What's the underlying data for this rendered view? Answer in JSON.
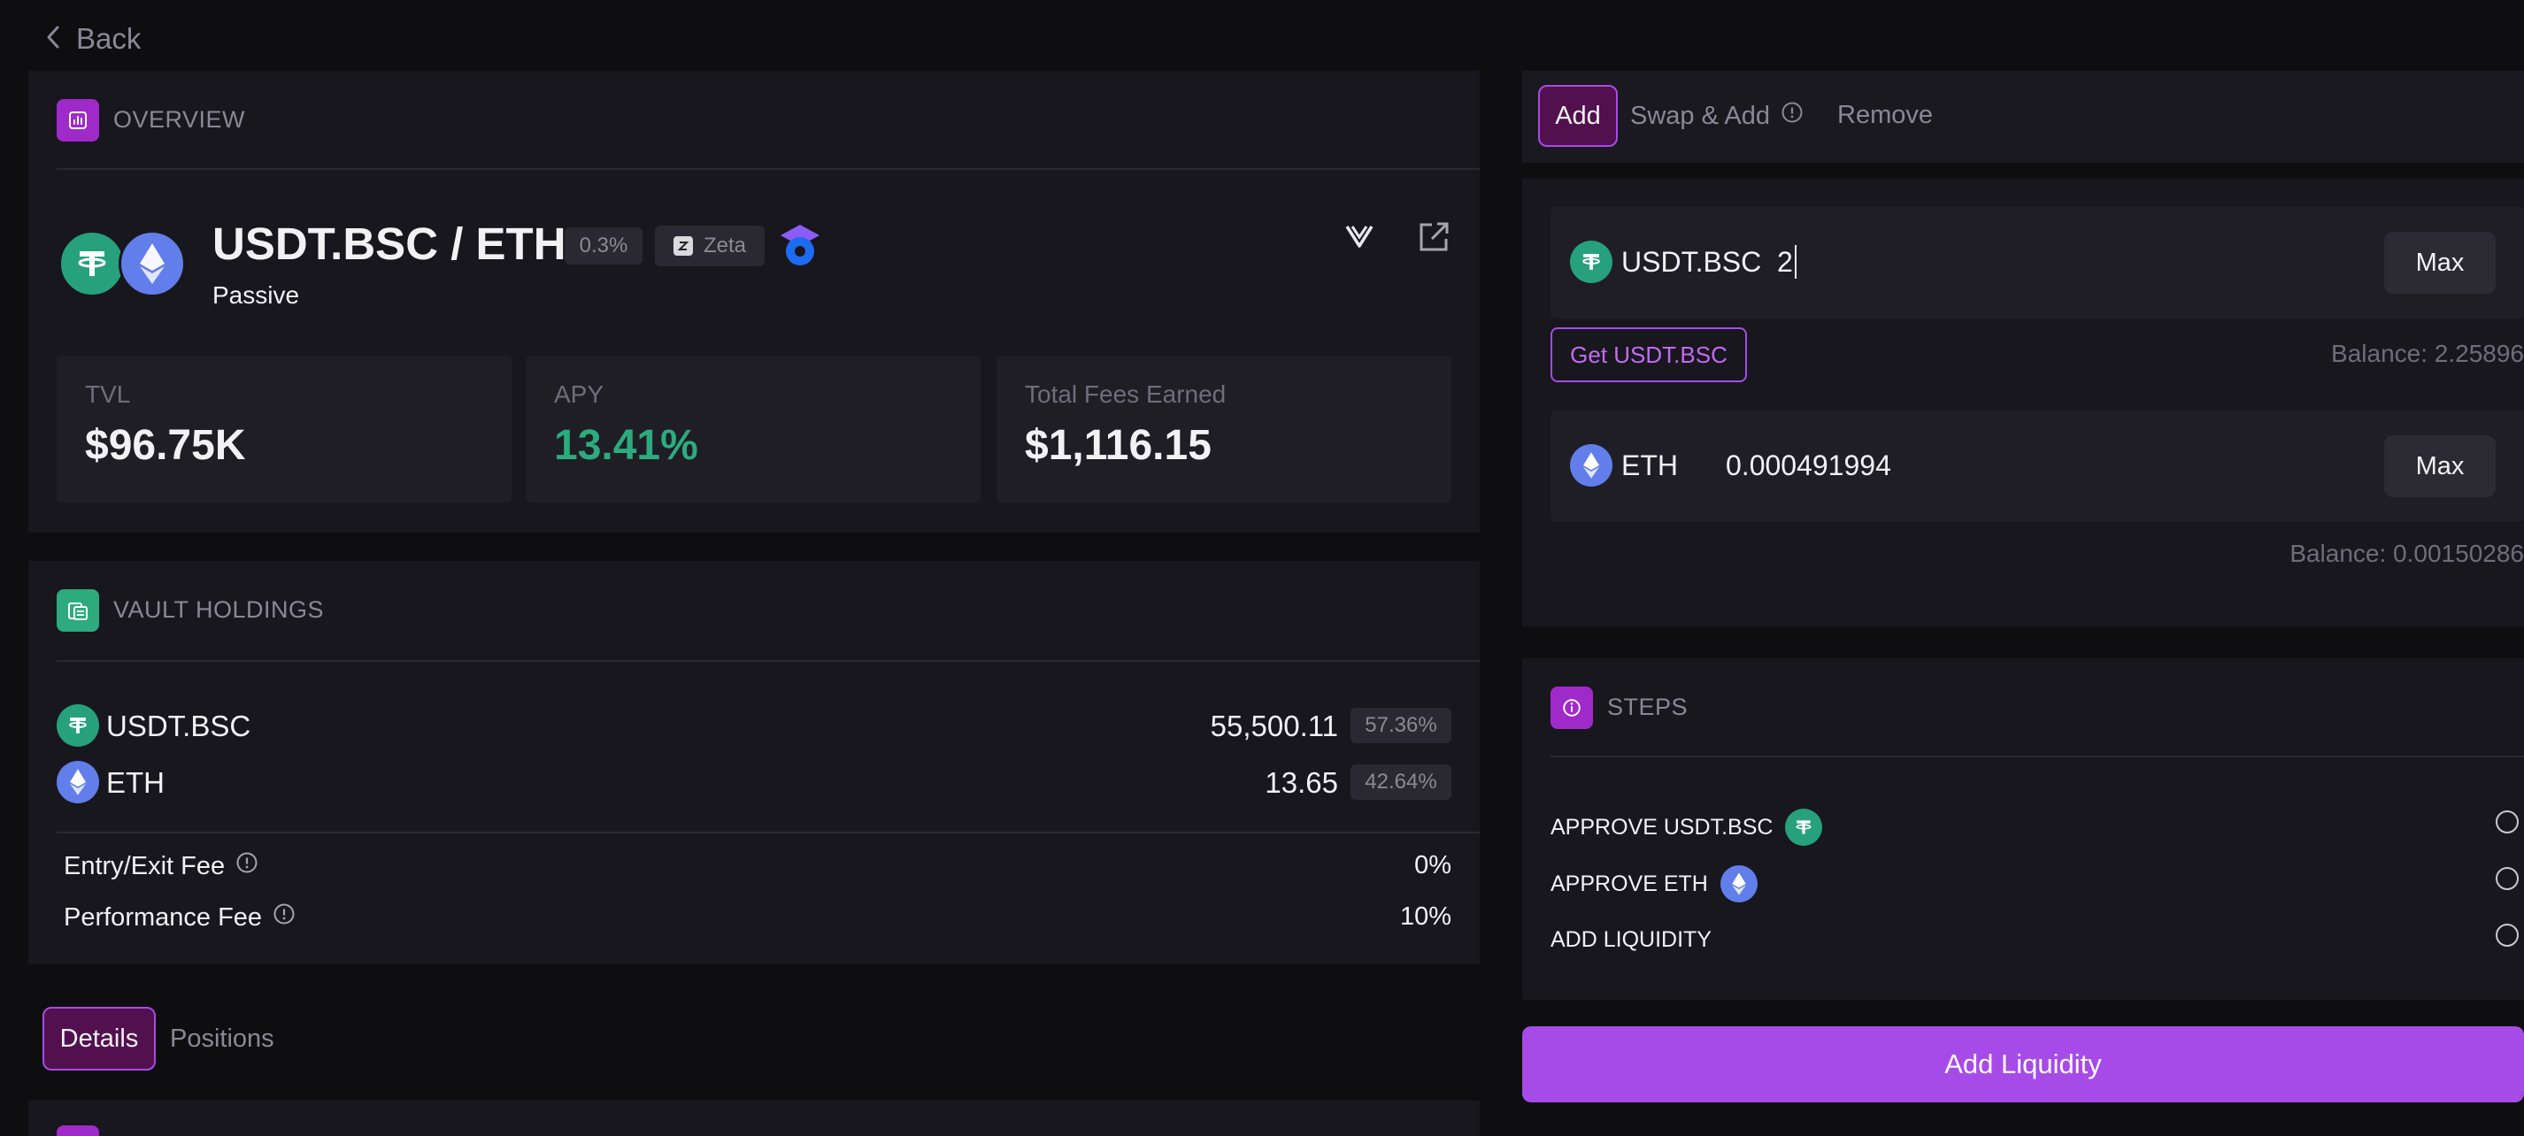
{
  "nav": {
    "back_label": "Back"
  },
  "overview": {
    "section_title": "OVERVIEW",
    "pair_name": "USDT.BSC / ETH",
    "fee_tier": "0.3%",
    "chain": "Zeta",
    "strategy": "Passive",
    "stats": [
      {
        "label": "TVL",
        "value": "$96.75K"
      },
      {
        "label": "APY",
        "value": "13.41%"
      },
      {
        "label": "Total Fees Earned",
        "value": "$1,116.15"
      }
    ]
  },
  "holdings": {
    "section_title": "VAULT HOLDINGS",
    "tokens": [
      {
        "symbol": "USDT.BSC",
        "amount": "55,500.11",
        "share": "57.36%"
      },
      {
        "symbol": "ETH",
        "amount": "13.65",
        "share": "42.64%"
      }
    ],
    "fees": [
      {
        "label": "Entry/Exit Fee",
        "value": "0%"
      },
      {
        "label": "Performance Fee",
        "value": "10%"
      }
    ]
  },
  "bottom_tabs": {
    "details": "Details",
    "positions": "Positions"
  },
  "action_tabs": {
    "add": "Add",
    "swap_add": "Swap & Add",
    "remove": "Remove"
  },
  "inputs": {
    "token1": {
      "symbol": "USDT.BSC",
      "value": "2",
      "max_label": "Max",
      "get_label": "Get USDT.BSC",
      "balance": "Balance: 2.25896"
    },
    "token2": {
      "symbol": "ETH",
      "value": "0.000491994",
      "max_label": "Max",
      "balance": "Balance: 0.00150286"
    }
  },
  "steps": {
    "section_title": "STEPS",
    "items": [
      "APPROVE USDT.BSC",
      "APPROVE ETH",
      "ADD LIQUIDITY"
    ]
  },
  "submit_label": "Add Liquidity",
  "colors": {
    "accent": "#a64be8",
    "green": "#2dab7f",
    "tether": "#26a17b",
    "eth": "#627eea"
  }
}
